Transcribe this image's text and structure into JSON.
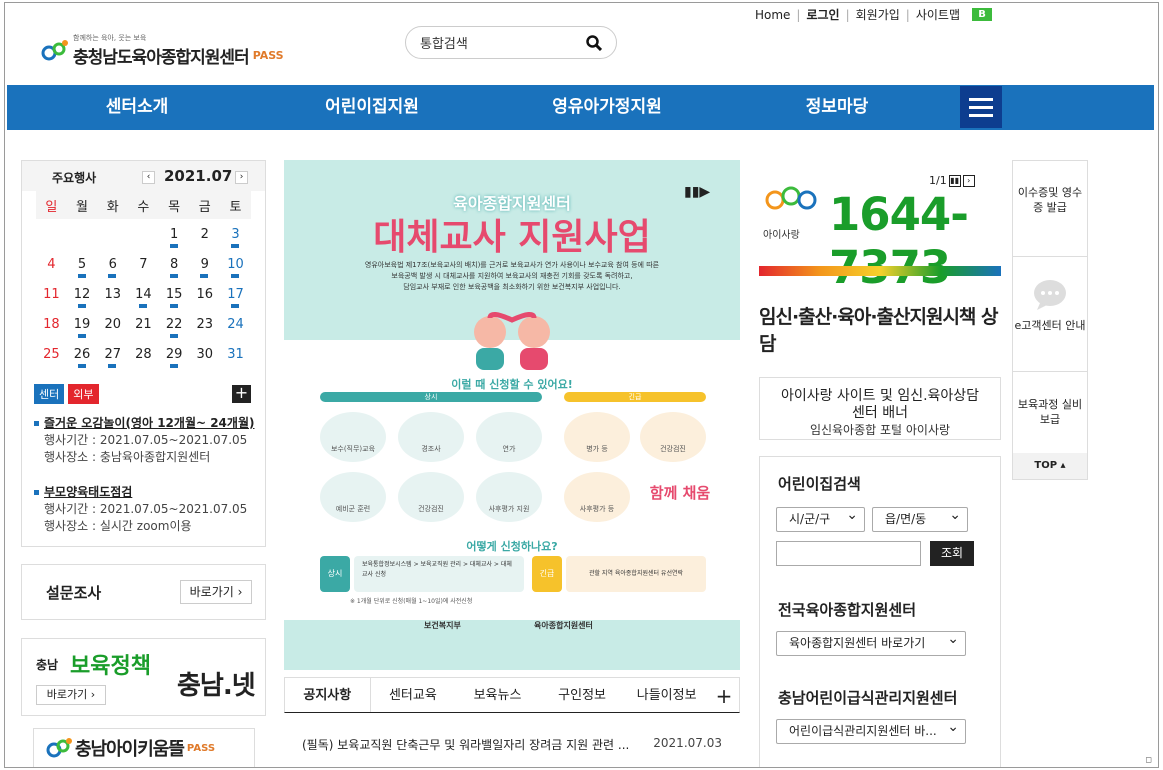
{
  "util": {
    "home": "Home",
    "login": "로그인",
    "join": "회원가입",
    "sitemap": "사이트맵",
    "badge": "B"
  },
  "logo": {
    "tagline": "함께하는 육아, 웃는 보육",
    "name": "충청남도육아종합지원센터",
    "pass": "PASS"
  },
  "search": {
    "placeholder": "통합검색"
  },
  "nav": [
    "센터소개",
    "어린이집지원",
    "영유아가정지원",
    "정보마당"
  ],
  "calendar": {
    "title": "주요행사",
    "month": "2021.07",
    "prev": "‹",
    "next": "›",
    "weekdays": [
      "일",
      "월",
      "화",
      "수",
      "목",
      "금",
      "토"
    ],
    "weeks": [
      [
        "",
        "",
        "",
        "",
        "1",
        "2",
        "3"
      ],
      [
        "4",
        "5",
        "6",
        "7",
        "8",
        "9",
        "10"
      ],
      [
        "11",
        "12",
        "13",
        "14",
        "15",
        "16",
        "17"
      ],
      [
        "18",
        "19",
        "20",
        "21",
        "22",
        "23",
        "24"
      ],
      [
        "25",
        "26",
        "27",
        "28",
        "29",
        "30",
        "31"
      ]
    ],
    "tab_center": "센터",
    "tab_outside": "외부",
    "plus": "+",
    "events": [
      {
        "title": "즐거운 오감놀이(영아 12개월~ 24개월)",
        "period": "행사기간 : 2021.07.05~2021.07.05",
        "place": "행사장소 : 충남육아종합지원센터"
      },
      {
        "title": "부모양육태도점검",
        "period": "행사기간 : 2021.07.05~2021.07.05",
        "place": "행사장소 : 실시간 zoom이용"
      }
    ]
  },
  "survey": {
    "label": "설문조사",
    "button": "바로가기 ›"
  },
  "banner_policy": {
    "region": "충남",
    "title": "보육정책",
    "button": "바로가기 ›",
    "site": "충남.넷"
  },
  "banner_kium": {
    "name": "충남아이키움뜰",
    "pass": "PASS"
  },
  "poster": {
    "subtitle": "육아종합지원센터",
    "title": "대체교사 지원사업",
    "desc1": "영유아보육법 제17조(보육교사의 배치)를 근거로 보육교사가 연가 사용이나 보수교육 참여 등에 따른",
    "desc2": "보육공백 발생 시 대체교사를 지원하여 보육교사의 재충전 기회를 갖도록 독려하고,",
    "desc3": "담임교사 부재로 인한 보육공백을 최소화하기 위한 보건복지부 사업입니다.",
    "q1": "이럴 때 신청할 수 있어요!",
    "sec_a": "상시",
    "sec_b": "긴급",
    "items": [
      "보수(직무)교육",
      "경조사",
      "연가",
      "병가 등",
      "건강검진",
      "사후평가 등",
      "예비군 훈련",
      "건강검진",
      "사후평가 지원"
    ],
    "together": "함께 채움",
    "q2": "어떻게 신청하나요?",
    "step_a": "상시",
    "step_b": "긴급",
    "step_a_text": "보육통합정보시스템 > 보육교직원 관리 > 대체교사 > 대체교사 신청",
    "step_b_text": "관할 지역 육아종합지원센터 유선연락",
    "note": "※ 1개월 단위로 신청(매월 1~10일)에 사전신청",
    "org1": "보건복지부",
    "org2": "육아종합지원센터"
  },
  "notice_tabs": [
    "공지사항",
    "센터교육",
    "보육뉴스",
    "구인정보",
    "나들이정보",
    "+"
  ],
  "notice": {
    "title": "(필독) 보육교직원 단축근무 및 워라밸일자리 장려금 지원 관련 ...",
    "date": "2021.07.03"
  },
  "right_banner": {
    "page": "1/1",
    "brand": "아이사랑",
    "phone": "1644-7373",
    "consult": "임신·출산·육아·출산지원시책 상담"
  },
  "alt_text": {
    "line1": "아이사랑 사이트 및 임신.육아상담",
    "line2": "센터 배너",
    "line3": "임신육아종합 포털 아이사랑"
  },
  "daycare_search": {
    "title": "어린이집검색",
    "sel1": "시/군/구",
    "sel2": "읍/면/동",
    "button": "조회"
  },
  "national": {
    "title": "전국육아종합지원센터",
    "select": "육아종합지원센터 바로가기"
  },
  "meal": {
    "title": "충남어린이급식관리지원센터",
    "select": "어린이급식관리지원센터 바..."
  },
  "quick": {
    "item1": "이수증및 영수증 발급",
    "item2": "e고객센터 안내",
    "item3": "보육과정 실비보급",
    "top": "TOP ▴"
  },
  "colors": {
    "nav": "#1a72bc",
    "accent": "#0d3d8f",
    "green": "#1a9d2a"
  }
}
